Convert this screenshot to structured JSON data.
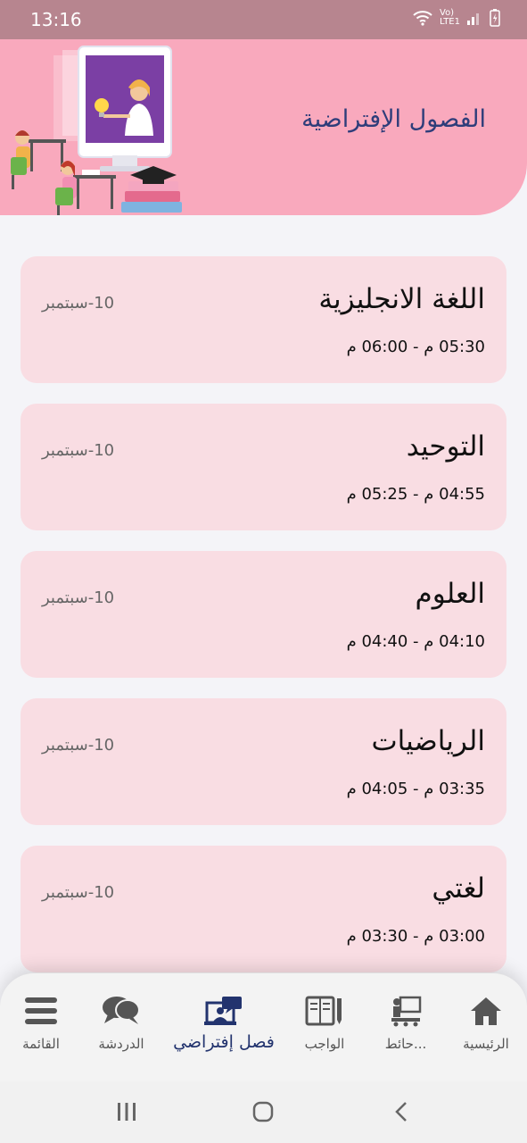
{
  "status_bar": {
    "time": "13:16",
    "network": "Vo) LTE1"
  },
  "header": {
    "title": "الفصول الإفتراضية"
  },
  "classes": [
    {
      "subject": "اللغة الانجليزية",
      "time": "05:30 م - 06:00 م",
      "date": "10-سبتمبر"
    },
    {
      "subject": "التوحيد",
      "time": "04:55 م - 05:25 م",
      "date": "10-سبتمبر"
    },
    {
      "subject": "العلوم",
      "time": "04:10 م - 04:40 م",
      "date": "10-سبتمبر"
    },
    {
      "subject": "الرياضيات",
      "time": "03:35 م - 04:05 م",
      "date": "10-سبتمبر"
    },
    {
      "subject": "لغتي",
      "time": "03:00 م - 03:30 م",
      "date": "10-سبتمبر"
    }
  ],
  "bottom_nav": {
    "home": "الرئيسية",
    "board": "حائط...",
    "homework": "الواجب",
    "virtual_class": "فصل إفتراضي",
    "chat": "الدردشة",
    "menu": "القائمة"
  },
  "colors": {
    "header_bg": "#f9a9bd",
    "card_bg": "#f9dde3",
    "accent": "#22336e",
    "status_bar": "#b7858f"
  }
}
